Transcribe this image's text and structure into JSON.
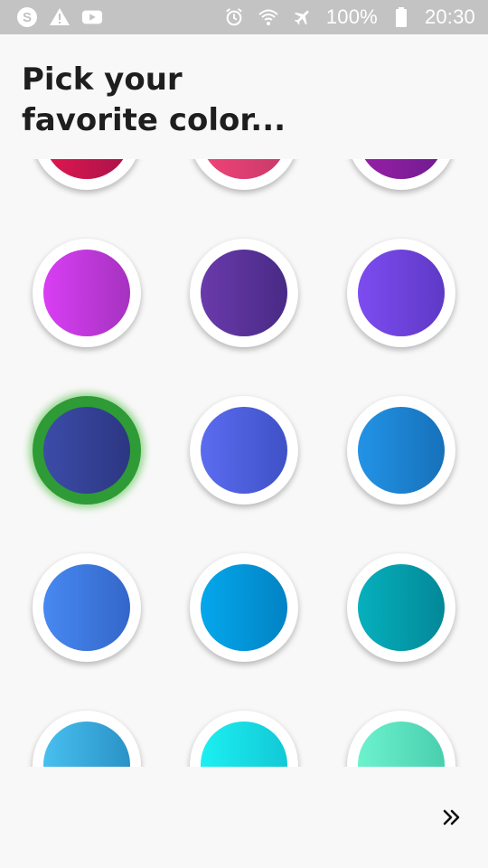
{
  "status_bar": {
    "battery": "100%",
    "time": "20:30",
    "left_icons": [
      "skype-icon",
      "warning-icon",
      "youtube-icon"
    ],
    "right_icons": [
      "alarm-icon",
      "wifi-icon",
      "airplane-mode-icon",
      "battery-icon"
    ]
  },
  "title": {
    "line1": "Pick your",
    "line2": "favorite color..."
  },
  "colors": [
    {
      "from": "#e2174f",
      "to": "#a8124a"
    },
    {
      "from": "#f14377",
      "to": "#c73a6a"
    },
    {
      "from": "#9a1fa8",
      "to": "#6e1c8e"
    },
    {
      "from": "#d93ef4",
      "to": "#a532c0"
    },
    {
      "from": "#6a3aab",
      "to": "#482a85"
    },
    {
      "from": "#7d4cf1",
      "to": "#5e39c6"
    },
    {
      "from": "#3c4ca8",
      "to": "#2c3682"
    },
    {
      "from": "#5b6cf0",
      "to": "#3f51c6"
    },
    {
      "from": "#2393e6",
      "to": "#1671ba"
    },
    {
      "from": "#4789f1",
      "to": "#3466c9"
    },
    {
      "from": "#04a7ec",
      "to": "#0283c4"
    },
    {
      "from": "#06b0bd",
      "to": "#038898"
    },
    {
      "from": "#47c0ef",
      "to": "#2a92c6"
    },
    {
      "from": "#1cf0f1",
      "to": "#12c8d6"
    },
    {
      "from": "#6cf2cd",
      "to": "#49cfae"
    }
  ],
  "selected_index": 6,
  "next_button": {
    "icon": "double-chevron-right-icon"
  }
}
